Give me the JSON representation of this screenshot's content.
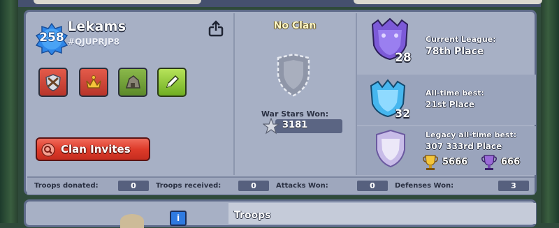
{
  "profile": {
    "xp_level": "258",
    "name": "Lekams",
    "tag": "#QJUPRJP8"
  },
  "icons": {
    "share": "share-icon",
    "badges": [
      "swords-shield-icon",
      "gold-crown-icon",
      "builder-hut-icon",
      "pencil-edit-icon"
    ],
    "clan_invites": "magnifier-icon",
    "clan_shield": "empty-clan-shield-icon",
    "war_star": "silver-star-icon",
    "info": "info-icon"
  },
  "clan_invites_button": {
    "label": "Clan Invites"
  },
  "clan": {
    "status": "No Clan",
    "war_stars_label": "War Stars Won:",
    "war_stars_value": "3181"
  },
  "league": {
    "current_label": "Current League:",
    "current_value": "78th Place",
    "current_badge_number": "28",
    "alltime_label": "All-time best:",
    "alltime_value": "21st Place",
    "alltime_badge_number": "32",
    "legacy_label": "Legacy all-time best:",
    "legacy_value": "307 333rd Place",
    "legacy_gold_trophies": "5666",
    "legacy_purple_trophies": "666"
  },
  "stats": [
    {
      "label": "Troops donated:",
      "value": "0"
    },
    {
      "label": "Troops received:",
      "value": "0"
    },
    {
      "label": "Attacks Won:",
      "value": "0"
    },
    {
      "label": "Defenses Won:",
      "value": "3"
    }
  ],
  "section2": {
    "info_glyph": "i",
    "title": "Troops"
  },
  "colors": {
    "panel": "#a7b0c5",
    "clan_invites_red": "#de3b2a",
    "edit_green": "#7fbf2a",
    "xp_blue": "#2e86e8"
  }
}
